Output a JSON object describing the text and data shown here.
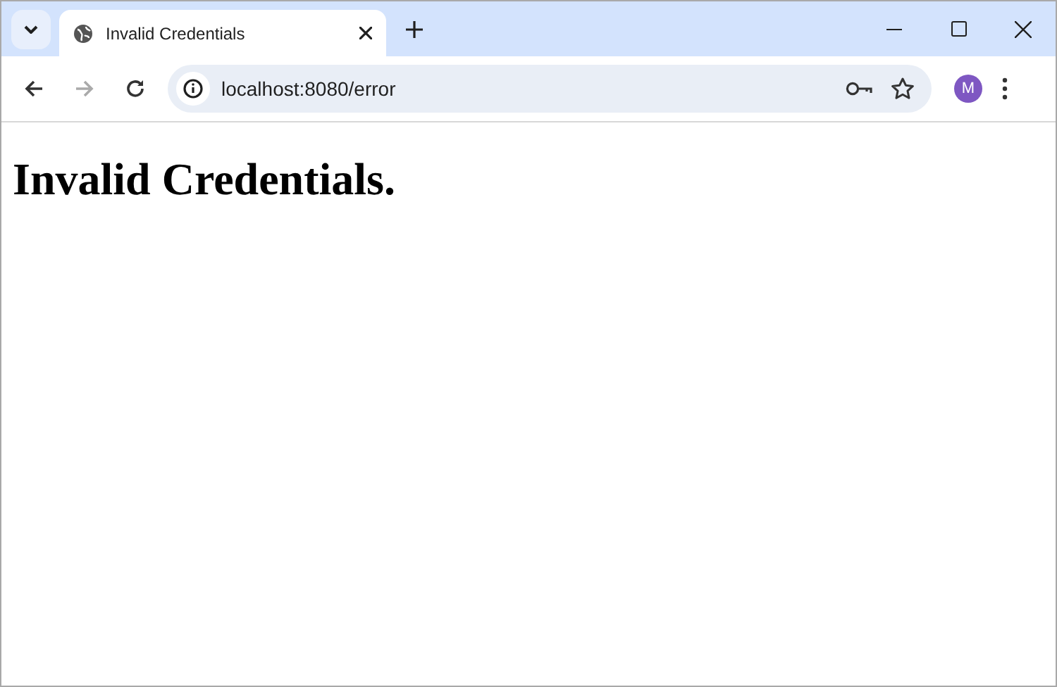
{
  "tabs": [
    {
      "title": "Invalid Credentials",
      "selected": true
    }
  ],
  "address_bar": {
    "url": "localhost:8080/error"
  },
  "profile": {
    "initial": "M",
    "color": "#7e57c2"
  },
  "page": {
    "heading": "Invalid Credentials."
  }
}
